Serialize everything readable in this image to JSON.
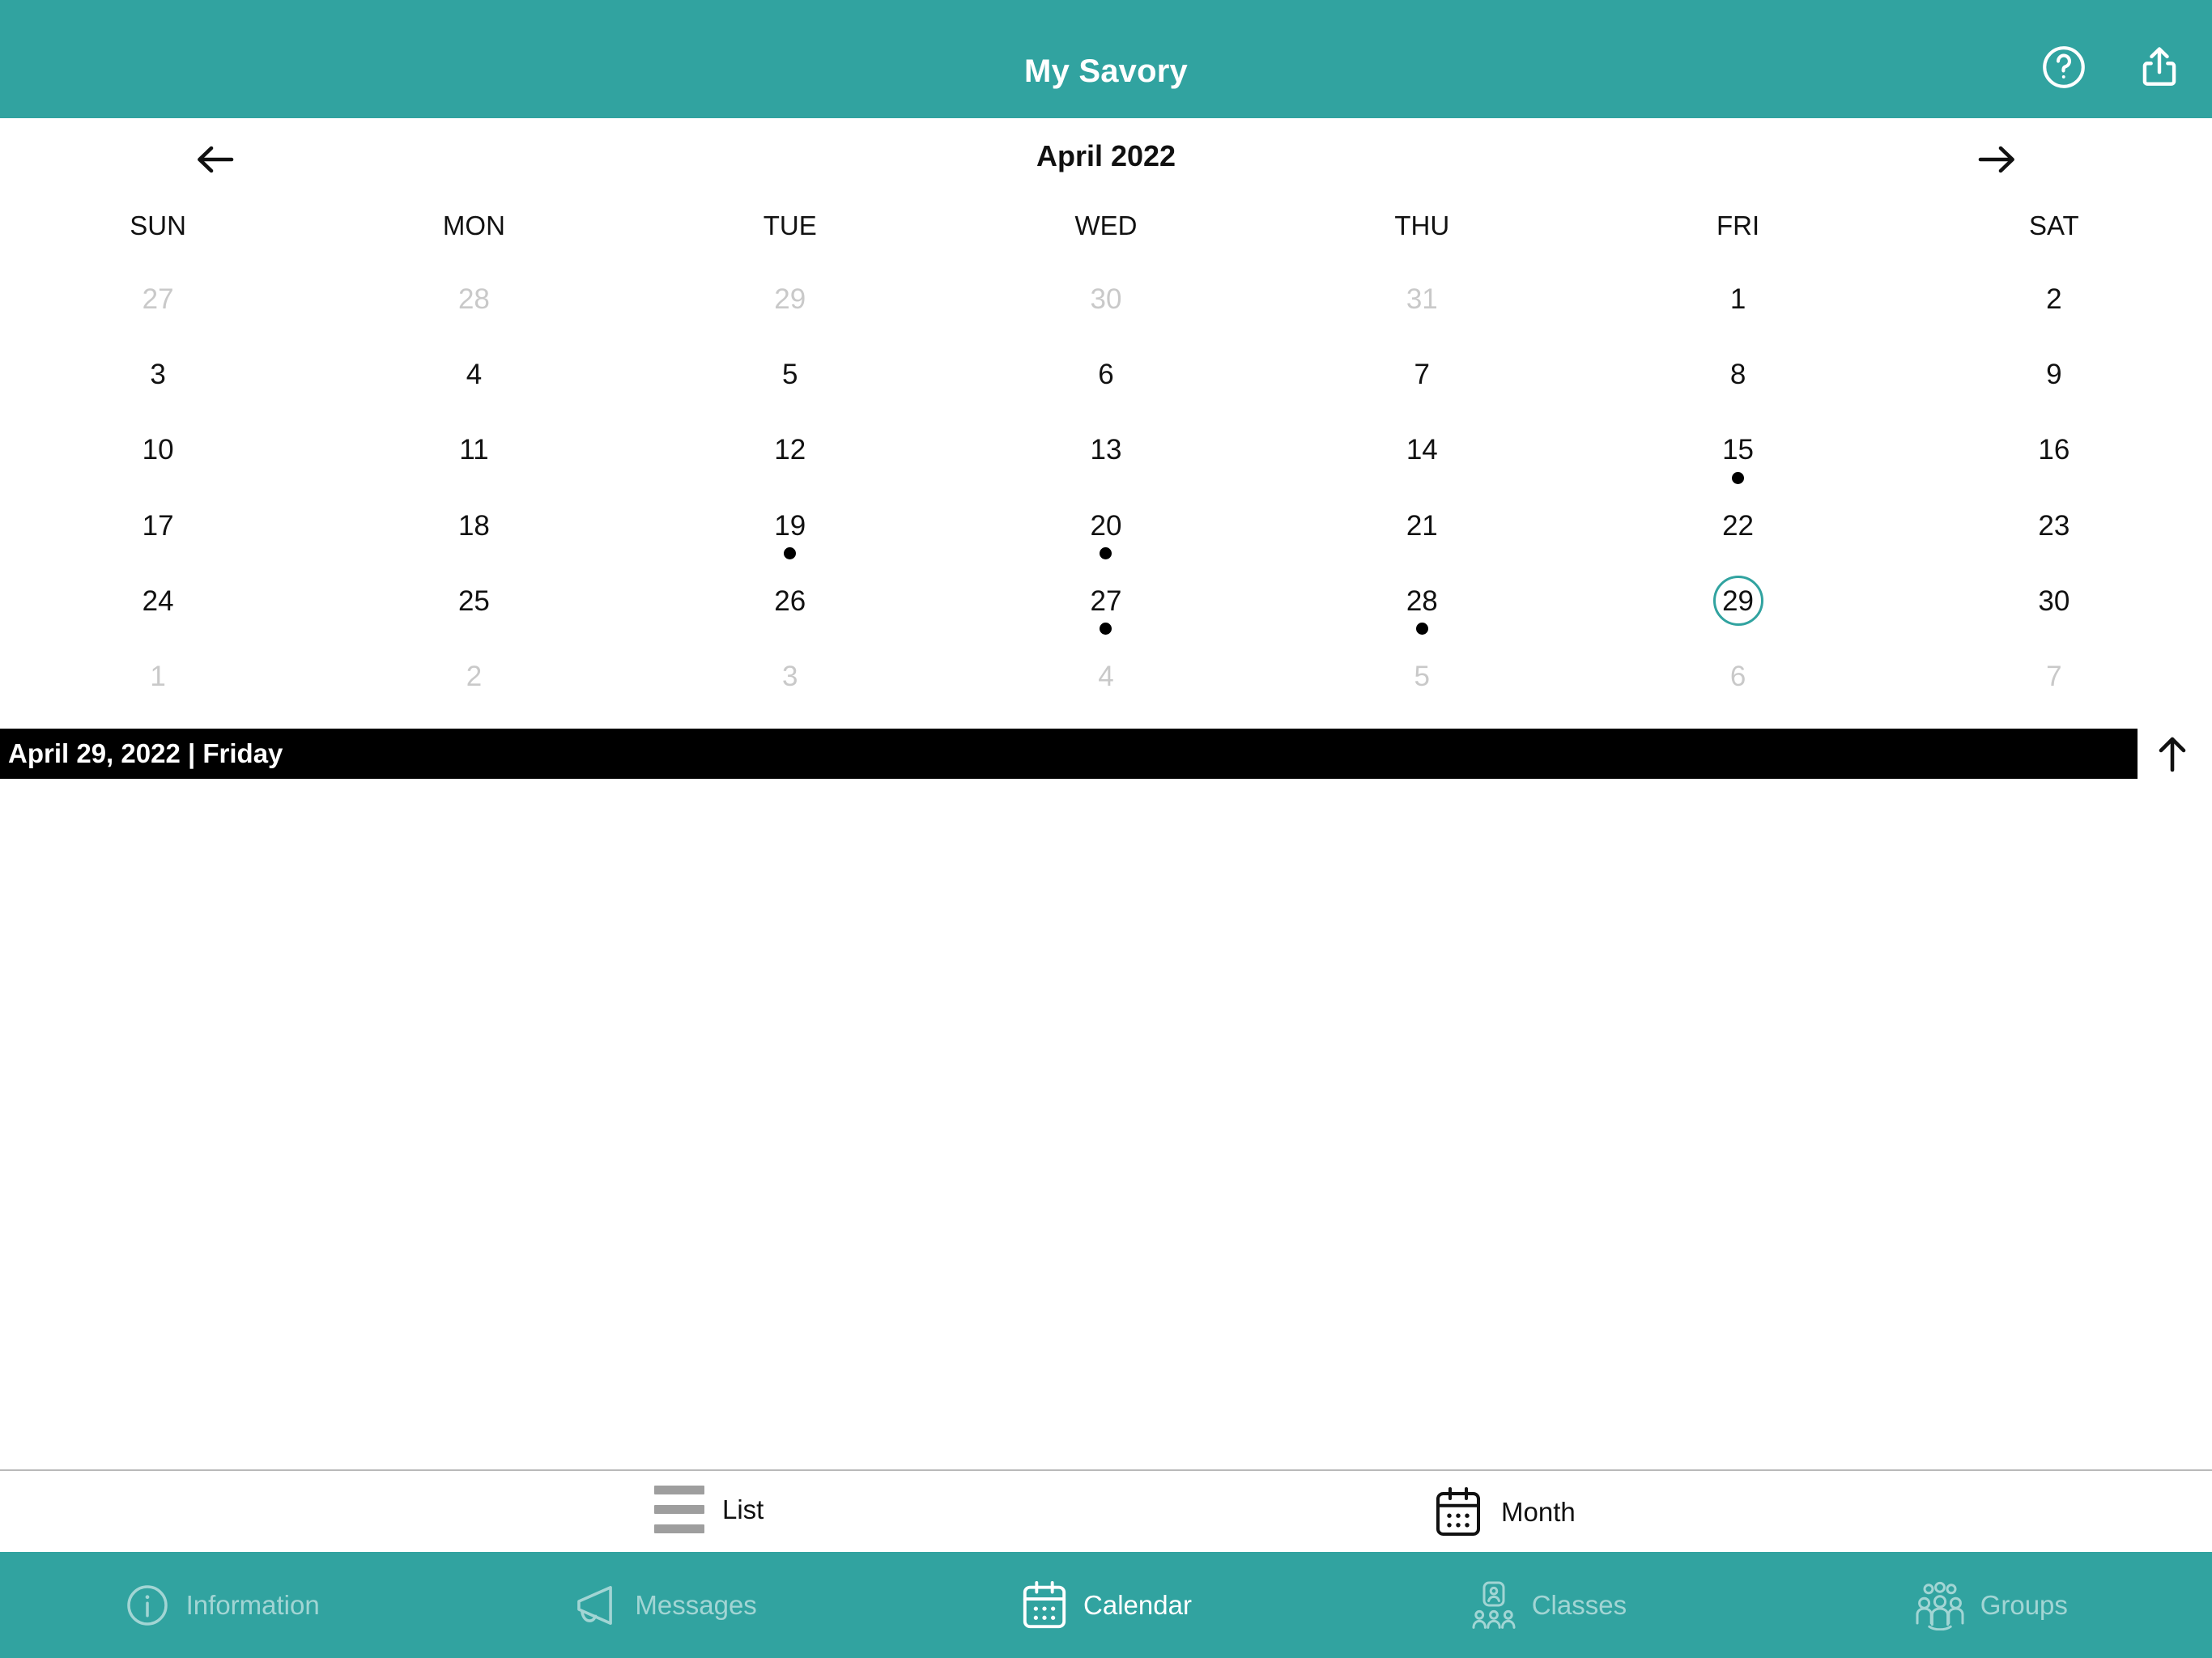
{
  "topbar": {
    "title": "My Savory",
    "help_icon": "question-circle-icon",
    "share_icon": "share-icon"
  },
  "calendar": {
    "month_label": "April 2022",
    "prev_icon": "arrow-left-icon",
    "next_icon": "arrow-right-icon",
    "weekdays": [
      "SUN",
      "MON",
      "TUE",
      "WED",
      "THU",
      "FRI",
      "SAT"
    ],
    "selected_day": 29,
    "accent_color": "#31A3A0",
    "days": [
      {
        "n": "27",
        "muted": true,
        "dot": false
      },
      {
        "n": "28",
        "muted": true,
        "dot": false
      },
      {
        "n": "29",
        "muted": true,
        "dot": false
      },
      {
        "n": "30",
        "muted": true,
        "dot": false
      },
      {
        "n": "31",
        "muted": true,
        "dot": false
      },
      {
        "n": "1",
        "muted": false,
        "dot": false
      },
      {
        "n": "2",
        "muted": false,
        "dot": false
      },
      {
        "n": "3",
        "muted": false,
        "dot": false
      },
      {
        "n": "4",
        "muted": false,
        "dot": false
      },
      {
        "n": "5",
        "muted": false,
        "dot": false
      },
      {
        "n": "6",
        "muted": false,
        "dot": false
      },
      {
        "n": "7",
        "muted": false,
        "dot": false
      },
      {
        "n": "8",
        "muted": false,
        "dot": false
      },
      {
        "n": "9",
        "muted": false,
        "dot": false
      },
      {
        "n": "10",
        "muted": false,
        "dot": false
      },
      {
        "n": "11",
        "muted": false,
        "dot": false
      },
      {
        "n": "12",
        "muted": false,
        "dot": false
      },
      {
        "n": "13",
        "muted": false,
        "dot": false
      },
      {
        "n": "14",
        "muted": false,
        "dot": false
      },
      {
        "n": "15",
        "muted": false,
        "dot": true
      },
      {
        "n": "16",
        "muted": false,
        "dot": false
      },
      {
        "n": "17",
        "muted": false,
        "dot": false
      },
      {
        "n": "18",
        "muted": false,
        "dot": false
      },
      {
        "n": "19",
        "muted": false,
        "dot": true
      },
      {
        "n": "20",
        "muted": false,
        "dot": true
      },
      {
        "n": "21",
        "muted": false,
        "dot": false
      },
      {
        "n": "22",
        "muted": false,
        "dot": false
      },
      {
        "n": "23",
        "muted": false,
        "dot": false
      },
      {
        "n": "24",
        "muted": false,
        "dot": false
      },
      {
        "n": "25",
        "muted": false,
        "dot": false
      },
      {
        "n": "26",
        "muted": false,
        "dot": false
      },
      {
        "n": "27",
        "muted": false,
        "dot": true
      },
      {
        "n": "28",
        "muted": false,
        "dot": true
      },
      {
        "n": "29",
        "muted": false,
        "dot": false,
        "selected": true
      },
      {
        "n": "30",
        "muted": false,
        "dot": false
      },
      {
        "n": "1",
        "muted": true,
        "dot": false
      },
      {
        "n": "2",
        "muted": true,
        "dot": false
      },
      {
        "n": "3",
        "muted": true,
        "dot": false
      },
      {
        "n": "4",
        "muted": true,
        "dot": false
      },
      {
        "n": "5",
        "muted": true,
        "dot": false
      },
      {
        "n": "6",
        "muted": true,
        "dot": false
      },
      {
        "n": "7",
        "muted": true,
        "dot": false
      }
    ]
  },
  "datebar": {
    "text": "April 29, 2022 | Friday",
    "collapse_icon": "arrow-up-icon"
  },
  "viewswitcher": {
    "list_label": "List",
    "list_icon": "list-icon",
    "month_label": "Month",
    "month_icon": "calendar-icon",
    "active": "Month"
  },
  "tabbar": {
    "tabs": [
      {
        "label": "Information",
        "icon": "info-circle-icon",
        "active": false
      },
      {
        "label": "Messages",
        "icon": "megaphone-icon",
        "active": false
      },
      {
        "label": "Calendar",
        "icon": "calendar-icon",
        "active": true
      },
      {
        "label": "Classes",
        "icon": "classes-icon",
        "active": false
      },
      {
        "label": "Groups",
        "icon": "groups-icon",
        "active": false
      }
    ]
  }
}
